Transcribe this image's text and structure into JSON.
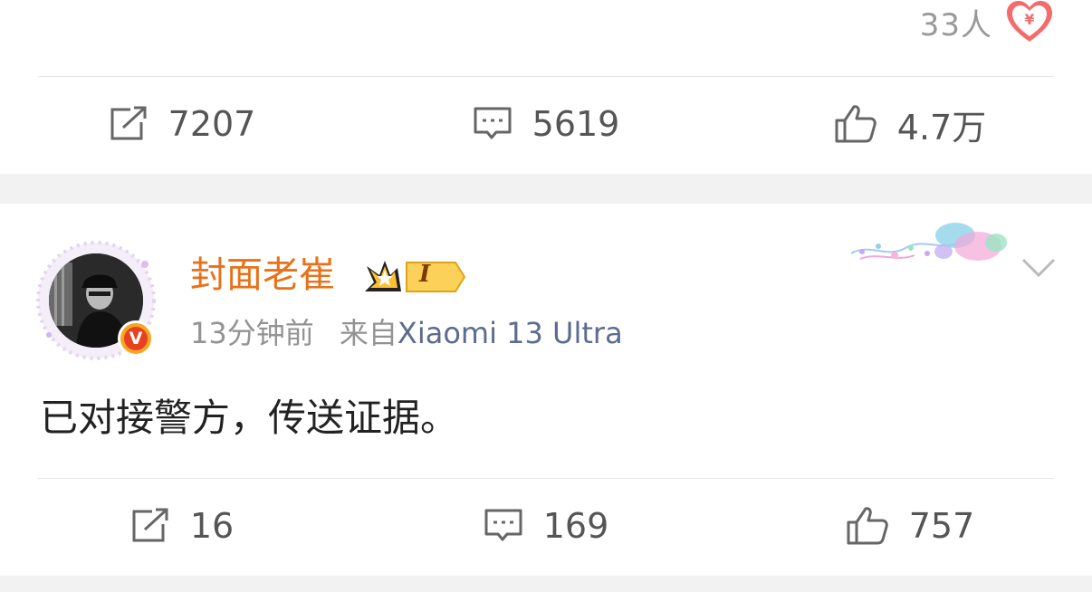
{
  "previous_post": {
    "reward": {
      "count": "33人",
      "icon": "reward-yuan-icon",
      "color": "#f46b6b"
    },
    "actions": {
      "repost": {
        "icon": "repost-icon",
        "count": "7207"
      },
      "comment": {
        "icon": "comment-icon",
        "count": "5619"
      },
      "like": {
        "icon": "thumbs-up-icon",
        "count": "4.7万"
      }
    }
  },
  "post": {
    "author": {
      "name": "封面老崔",
      "name_color": "#e8711a",
      "vip_badge_text": "I",
      "verified_letter": "V"
    },
    "meta": {
      "time": "13分钟前",
      "source_prefix": "来自",
      "device": "Xiaomi 13 Ultra"
    },
    "text": "已对接警方，传送证据。",
    "actions": {
      "repost": {
        "icon": "repost-icon",
        "count": "16"
      },
      "comment": {
        "icon": "comment-icon",
        "count": "169"
      },
      "like": {
        "icon": "thumbs-up-icon",
        "count": "757"
      }
    }
  },
  "colors": {
    "page_background": "#f2f2f2",
    "card_background": "#ffffff",
    "icon_gray": "#666666",
    "link_blue": "#5b6c8f"
  }
}
